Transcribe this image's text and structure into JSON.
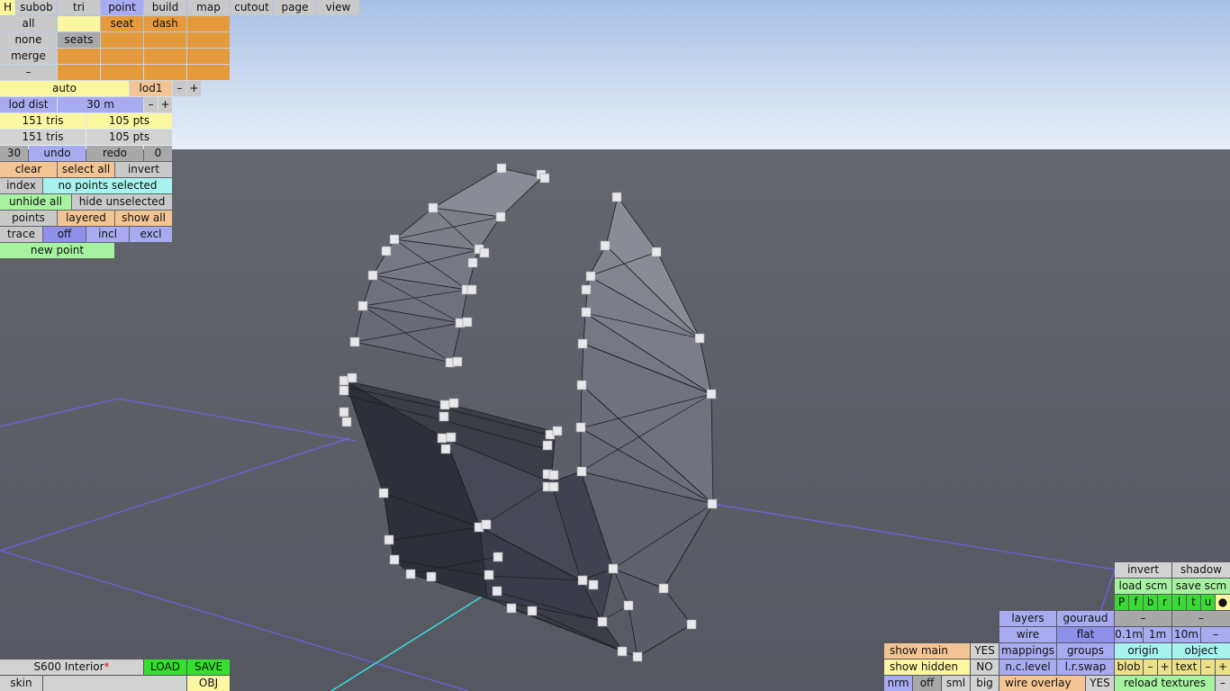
{
  "colors": {
    "sky_top": "#a9c3e7",
    "sky_bottom": "#e8eff8",
    "floor": "#5a5d66",
    "menu_blue": "#a9abf0",
    "menu_yellow": "#fbf6a0",
    "menu_orange": "#e59a3c",
    "menu_cyan": "#a8f3ef",
    "menu_green": "#a6f2a0",
    "grid_line": "#6a62e8"
  },
  "topbar": {
    "h": "H",
    "subob": "subob",
    "tri": "tri",
    "point": "point",
    "build": "build",
    "map": "map",
    "cutout": "cutout",
    "page": "page",
    "view": "view"
  },
  "selection": {
    "all": "all",
    "none": "none",
    "merge": "merge",
    "minus": "–",
    "seat": "seat",
    "dash": "dash",
    "seats": "seats"
  },
  "lod": {
    "auto": "auto",
    "level": "lod1",
    "minus": "–",
    "plus": "+",
    "dist_label": "lod dist",
    "dist_value": "30 m",
    "dist_minus": "–",
    "dist_plus": "+"
  },
  "stats": {
    "tris_a": "151 tris",
    "pts_a": "105 pts",
    "tris_b": "151 tris",
    "pts_b": "105 pts"
  },
  "history": {
    "count": "30",
    "undo": "undo",
    "redo": "redo",
    "redo_count": "0"
  },
  "points_panel": {
    "clear": "clear",
    "select_all": "select all",
    "invert": "invert",
    "index": "index",
    "status": "no points selected",
    "unhide_all": "unhide all",
    "hide_unselected": "hide unselected",
    "points": "points",
    "layered": "layered",
    "show_all": "show all",
    "trace": "trace",
    "off": "off",
    "incl": "incl",
    "excl": "excl",
    "new_point": "new point"
  },
  "file": {
    "name": "S600 Interior",
    "modified_mark": "*",
    "load": "LOAD",
    "save": "SAVE",
    "skin": "skin",
    "obj": "OBJ"
  },
  "display": {
    "invert": "invert",
    "shadow": "shadow",
    "load_scm": "load scm",
    "save_scm": "save scm",
    "flags": [
      "P",
      "f",
      "b",
      "r",
      "l",
      "t",
      "u",
      "●"
    ],
    "layers": "layers",
    "gouraud": "gouraud",
    "minus1": "–",
    "minus2": "–",
    "wire": "wire",
    "flat": "flat",
    "scale_01": "0.1m",
    "scale_1": "1m",
    "scale_10": "10m",
    "scale_minus": "–",
    "show_main": "show main",
    "show_main_val": "YES",
    "mappings": "mappings",
    "groups": "groups",
    "origin": "origin",
    "object": "object",
    "show_hidden": "show hidden",
    "show_hidden_val": "NO",
    "nc_level": "n.c.level",
    "lr_swap": "l.r.swap",
    "blob": "blob",
    "blob_minus": "–",
    "blob_plus": "+",
    "text": "text",
    "text_minus": "–",
    "text_plus": "+",
    "nrm": "nrm",
    "nrm_off": "off",
    "sml": "sml",
    "big": "big",
    "wire_overlay": "wire overlay",
    "wire_overlay_val": "YES",
    "reload_textures": "reload textures",
    "reload_minus": "–"
  }
}
